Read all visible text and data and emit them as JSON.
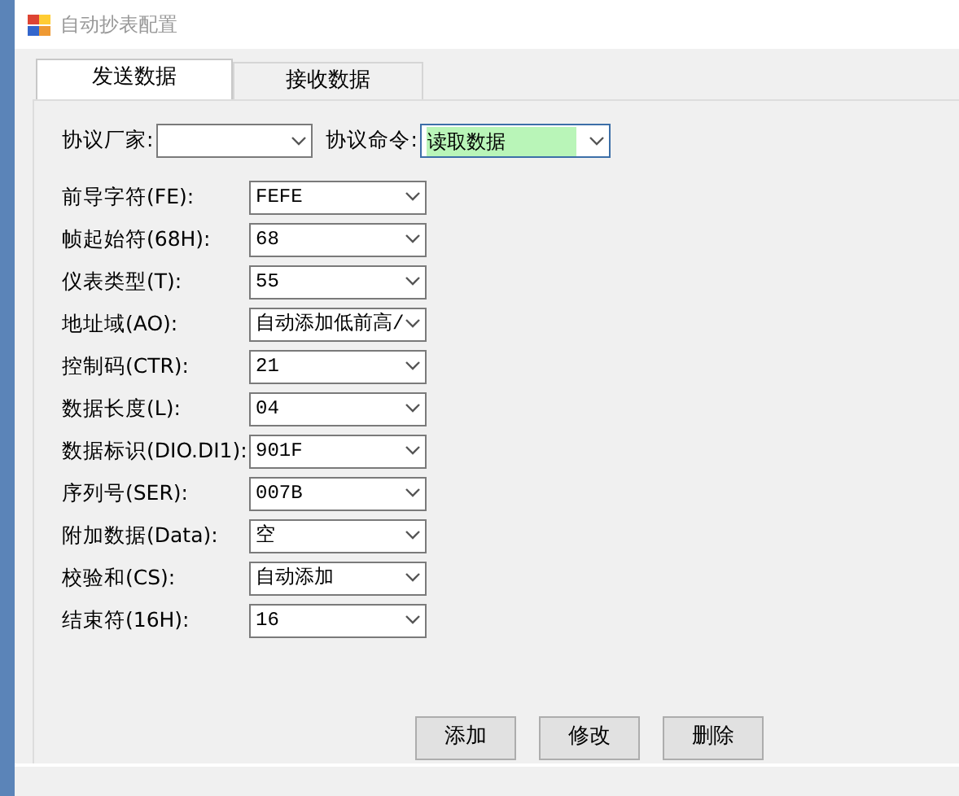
{
  "window": {
    "title": "自动抄表配置"
  },
  "tabs": [
    {
      "label": "发送数据",
      "selected": true
    },
    {
      "label": "接收数据",
      "selected": false
    }
  ],
  "protocol": [
    {
      "label": "协议厂家:",
      "highlighted": false
    },
    {
      "label": "协议命令:",
      "value": "读取数据",
      "highlighted": true
    }
  ],
  "fields": [
    {
      "label": "前导字符(FE):",
      "value": "FEFE"
    },
    {
      "label": "帧起始符(68H):",
      "value": "68"
    },
    {
      "label": "仪表类型(T):",
      "value": "55"
    },
    {
      "label": "地址域(AO):",
      "value": "自动添加低前高/"
    },
    {
      "label": "控制码(CTR):",
      "value": "21"
    },
    {
      "label": "数据长度(L):",
      "value": "04"
    },
    {
      "label": "数据标识(DIO.DI1):",
      "value": "901F"
    },
    {
      "label": "序列号(SER):",
      "value": "007B"
    },
    {
      "label": "附加数据(Data):",
      "value": "空"
    },
    {
      "label": "校验和(CS):",
      "value": "自动添加"
    },
    {
      "label": "结束符(16H):",
      "value": "16"
    }
  ],
  "buttons": [
    "添加",
    "修改",
    "删除"
  ]
}
